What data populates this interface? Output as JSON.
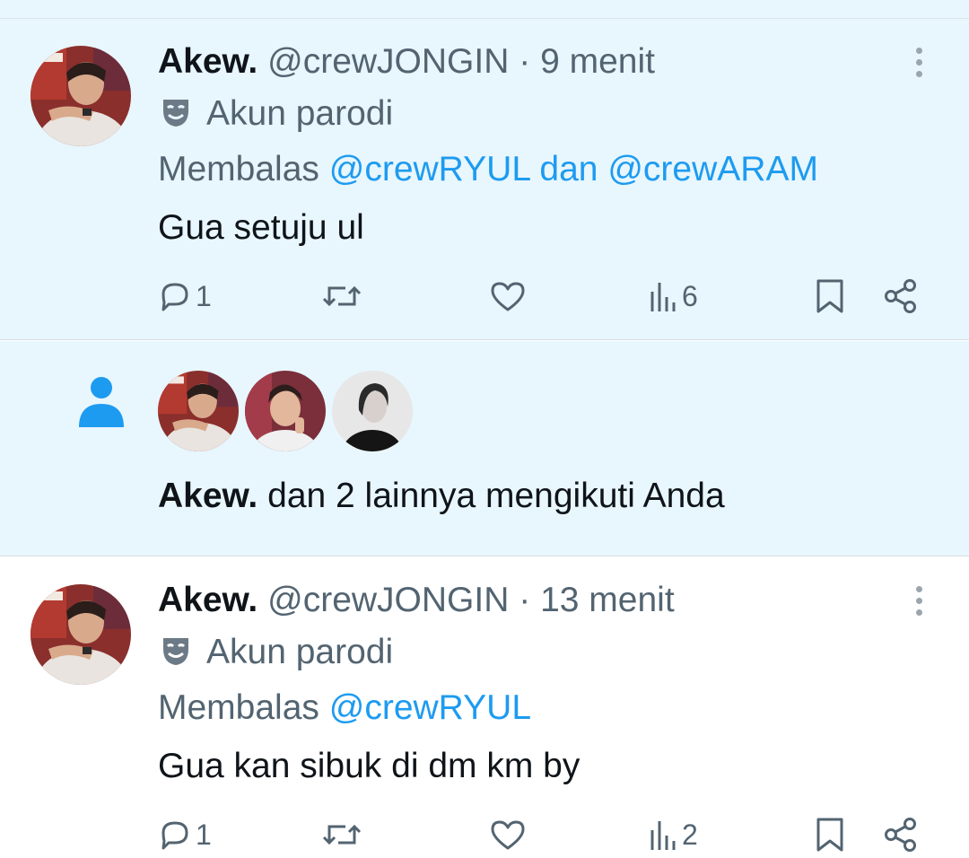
{
  "tweets": [
    {
      "name": "Akew.",
      "handle": "@crewJONGIN",
      "dot": "·",
      "time": "9 menit",
      "parody_label": "Akun parodi",
      "replying_prefix": "Membalas",
      "reply_to_1": "@crewRYUL",
      "reply_joiner": "dan",
      "reply_to_2": "@crewARAM",
      "text": "Gua setuju ul",
      "replies": "1",
      "views": "6"
    },
    {
      "name": "Akew.",
      "handle": "@crewJONGIN",
      "dot": "·",
      "time": "13 menit",
      "parody_label": "Akun parodi",
      "replying_prefix": "Membalas",
      "reply_to_1": "@crewRYUL",
      "text": "Gua kan sibuk di dm km by",
      "replies": "1",
      "views": "2"
    }
  ],
  "notification": {
    "name": "Akew.",
    "text": "dan 2 lainnya mengikuti Anda"
  },
  "icons": {
    "more": "more-vertical-icon",
    "parody": "theater-mask-icon",
    "reply": "reply-bubble-icon",
    "retweet": "retweet-icon",
    "like": "heart-icon",
    "views": "bar-chart-icon",
    "bookmark": "bookmark-icon",
    "share": "share-icon",
    "follow": "person-icon"
  },
  "colors": {
    "highlight_bg": "#e8f6fd",
    "link": "#1d9bf0",
    "secondary_text": "#536471",
    "primary_text": "#0f1419"
  }
}
